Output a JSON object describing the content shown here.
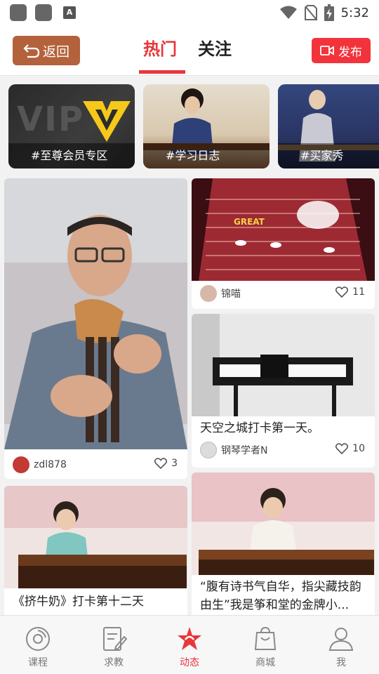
{
  "status_bar": {
    "time": "5:32"
  },
  "header": {
    "back_label": "返回",
    "tabs": [
      {
        "label": "热门",
        "active": true
      },
      {
        "label": "关注",
        "active": false
      }
    ],
    "publish_label": "发布"
  },
  "topics": [
    {
      "label": "#至尊会员专区",
      "image_text": "VIP"
    },
    {
      "label": "#学习日志"
    },
    {
      "label": "#买家秀"
    }
  ],
  "feed": [
    {
      "title": "",
      "user": "zdl878",
      "likes": "3"
    },
    {
      "title": "",
      "user": "锦喵",
      "likes": "11",
      "image_text": "GREAT"
    },
    {
      "title": "天空之城打卡第一天。",
      "user": "钢琴学者N",
      "likes": "10"
    },
    {
      "title": "《挤牛奶》打卡第十二天"
    },
    {
      "title": "“腹有诗书气自华，指尖藏技韵由生”我是筝和堂的金牌小..."
    }
  ],
  "bottom_nav": [
    {
      "label": "课程",
      "icon": "disc-icon",
      "active": false
    },
    {
      "label": "求教",
      "icon": "edit-icon",
      "active": false
    },
    {
      "label": "动态",
      "icon": "star-icon",
      "active": true
    },
    {
      "label": "商城",
      "icon": "shopping-bag-icon",
      "active": false
    },
    {
      "label": "我",
      "icon": "user-icon",
      "active": false
    }
  ],
  "colors": {
    "accent": "#e8363b",
    "back_button": "#b4623c",
    "publish_button": "#f2333b"
  }
}
